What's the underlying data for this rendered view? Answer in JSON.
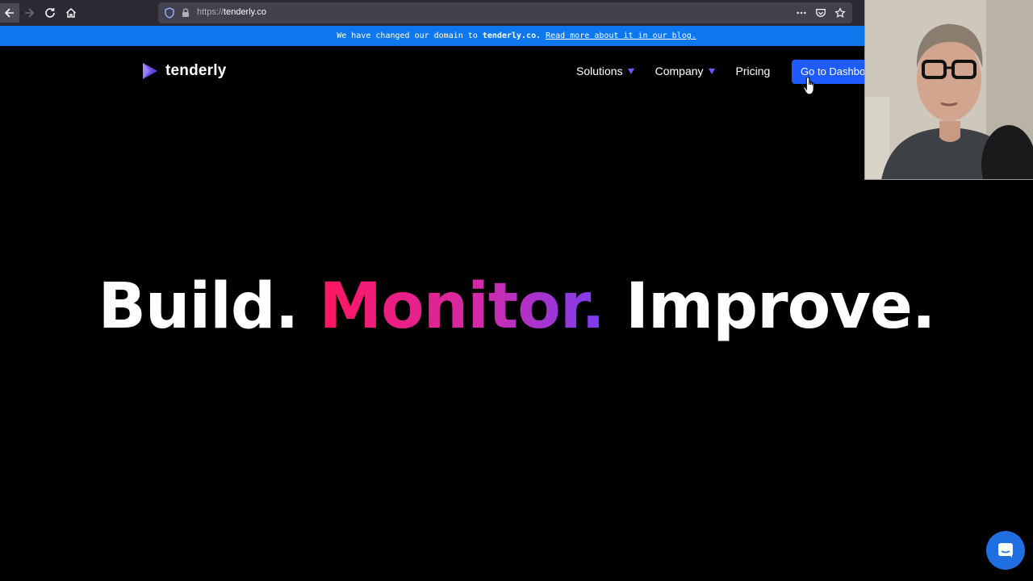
{
  "browser": {
    "url_prefix": "https://",
    "url_domain": "tenderly.co"
  },
  "banner": {
    "text": "We have changed our domain to",
    "domain": "tenderly.co.",
    "link": "Read more about it in our blog."
  },
  "brand": {
    "name": "tenderly"
  },
  "nav": {
    "solutions": "Solutions",
    "company": "Company",
    "pricing": "Pricing",
    "cta": "Go to Dashboard"
  },
  "hero": {
    "word1": "Build.",
    "word2": "Monitor.",
    "word3": "Improve."
  },
  "colors": {
    "banner": "#0d77ee",
    "cta": "#1f5cff",
    "caret": "#6f54ff",
    "gradient_start": "#ff1561",
    "gradient_end": "#7a3cf5"
  }
}
